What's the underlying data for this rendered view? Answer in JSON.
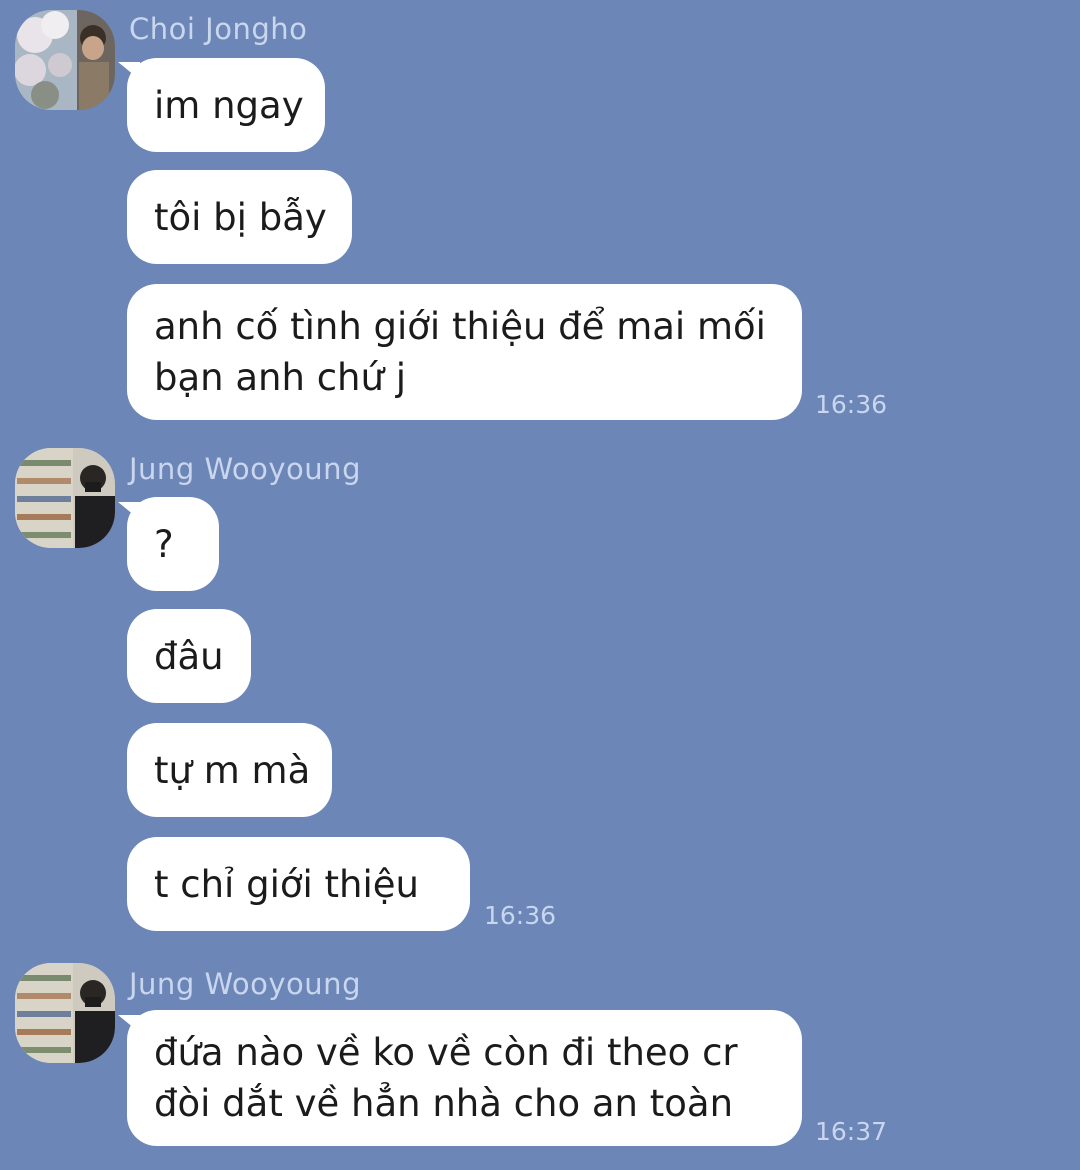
{
  "theme": {
    "background": "#6b86b7",
    "bubble": "#ffffff",
    "meta_text": "#c9d6ee"
  },
  "groups": [
    {
      "sender": "Choi Jongho",
      "avatar_icon": "avatar-cherry-blossom-photo",
      "messages": [
        "im ngay",
        "tôi bị bẫy",
        "anh cố tình giới thiệu để mai mối bạn anh chứ j"
      ],
      "time": "16:36"
    },
    {
      "sender": "Jung Wooyoung",
      "avatar_icon": "avatar-store-photo",
      "messages": [
        "?",
        "đâu",
        "tự m mà",
        "t chỉ giới thiệu"
      ],
      "time": "16:36"
    },
    {
      "sender": "Jung Wooyoung",
      "avatar_icon": "avatar-store-photo",
      "messages": [
        "đứa nào về ko về còn đi theo cr đòi dắt về hẳn nhà cho an toàn"
      ],
      "time": "16:37"
    }
  ]
}
